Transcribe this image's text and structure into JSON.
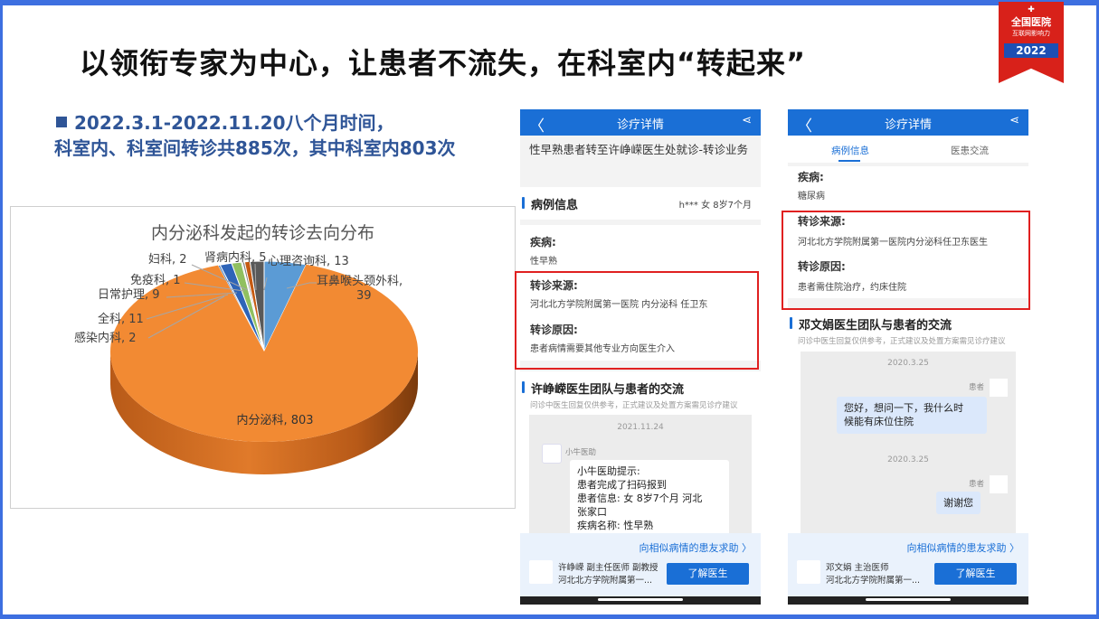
{
  "slide": {
    "title": "以领衔专家为中心，让患者不流失，在科室内“转起来”",
    "bullet_line1": "2022.3.1-2022.11.20八个月时间，",
    "bullet_line2": "科室内、科室间转诊共885次，其中科室内803次"
  },
  "badge": {
    "line1": "全国医院",
    "line2": "互联网影响力",
    "year": "2022",
    "icon": "hospital-icon"
  },
  "chart_data": {
    "type": "pie",
    "title": "内分泌科发起的转诊去向分布",
    "labels": [
      "内分泌科",
      "耳鼻喉头颈外科",
      "心理咨询科",
      "肾病内科",
      "妇科",
      "免疫科",
      "日常护理",
      "全科",
      "感染内科"
    ],
    "values": [
      803,
      39,
      13,
      5,
      2,
      1,
      9,
      11,
      2
    ],
    "data_labels": [
      "内分泌科, 803",
      "耳鼻喉头颈外科, 39",
      "心理咨询科, 13",
      "肾病内科, 5",
      "妇科, 2",
      "免疫科, 1",
      "日常护理, 9",
      "全科, 11",
      "感染内科, 2"
    ],
    "colors": [
      "#f28a33",
      "#5b9bd5",
      "#595959",
      "#c55a11",
      "#808080",
      "#70ad47",
      "#90c060",
      "#2e64b8",
      "#3a78c2"
    ]
  },
  "phone1": {
    "header_title": "诊疗详情",
    "banner": "性早熟患者转至许峥嵘医生处就诊-转诊业务",
    "section_title": "病例信息",
    "patient": "h*** 女 8岁7个月",
    "disease_label": "疾病:",
    "disease_value": "性早熟",
    "source_label": "转诊来源:",
    "source_value": "河北北方学院附属第一医院 内分泌科 任卫东",
    "reason_label": "转诊原因:",
    "reason_value": "患者病情需要其他专业方向医生介入",
    "team_title": "许峥嵘医生团队与患者的交流",
    "team_note": "问诊中医生回复仅供参考，正式建议及处置方案需见诊疗建议",
    "chat_date": "2021.11.24",
    "assistant_name": "小牛医助",
    "bubble_lines": [
      "小牛医助提示:",
      "患者完成了扫码报到",
      "患者信息: 女 8岁7个月 河北",
      "张家口",
      "疾病名称: 性早熟"
    ],
    "ask_text": "向相似病情的患友求助 〉",
    "doctor_line1": "许峥嵘  副主任医师  副教授",
    "doctor_line2": "河北北方学院附属第一...",
    "button_label": "了解医生"
  },
  "phone2": {
    "header_title": "诊疗详情",
    "tab_case": "病例信息",
    "tab_chat": "医患交流",
    "disease_label": "疾病:",
    "disease_value": "糖尿病",
    "source_label": "转诊来源:",
    "source_value": "河北北方学院附属第一医院内分泌科任卫东医生",
    "reason_label": "转诊原因:",
    "reason_value": "患者需住院治疗，约床住院",
    "team_title": "邓文娟医生团队与患者的交流",
    "team_note": "问诊中医生回复仅供参考，正式建议及处置方案需见诊疗建议",
    "date1": "2020.3.25",
    "role1": "患者",
    "msg1_lines": [
      "您好，想问一下，我什么时",
      "候能有床位住院"
    ],
    "date2": "2020.3.25",
    "role2": "患者",
    "msg2": "谢谢您",
    "ask_text": "向相似病情的患友求助 〉",
    "doctor_line1": "邓文娟  主治医师",
    "doctor_line2": "河北北方学院附属第一...",
    "button_label": "了解医生"
  }
}
